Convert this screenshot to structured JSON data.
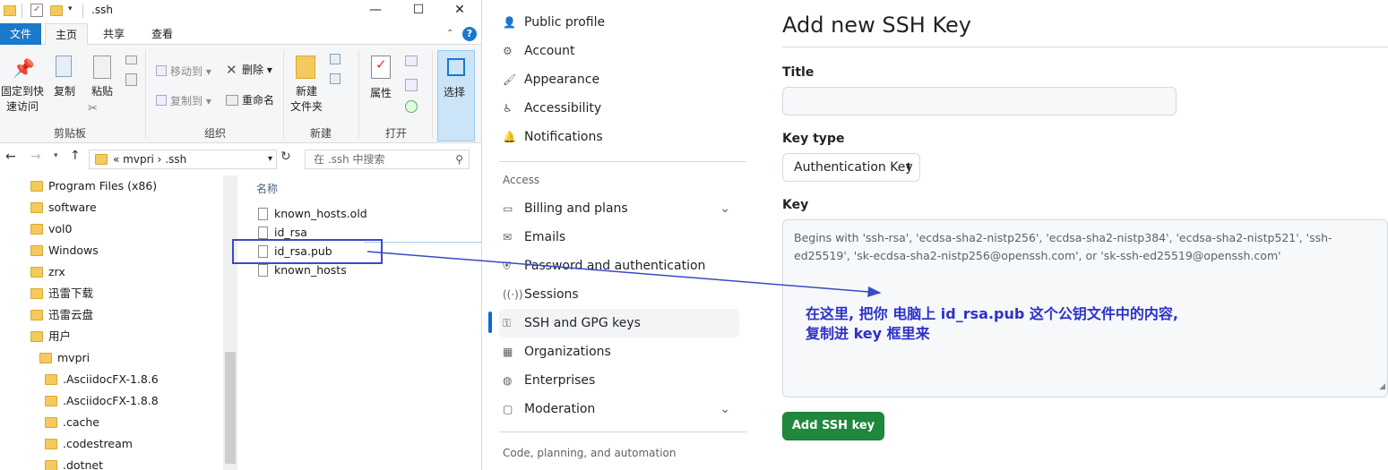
{
  "explorer": {
    "title": ".ssh",
    "window_controls": {
      "minimize": "—",
      "maximize": "☐",
      "close": "✕"
    },
    "tabs": {
      "file": "文件",
      "home": "主页",
      "share": "共享",
      "view": "查看"
    },
    "help": "?",
    "ribbon": {
      "pin": "固定到快\n速访问",
      "copy": "复制",
      "paste": "粘贴",
      "move_to": "移动到",
      "delete": "删除",
      "copy_to": "复制到",
      "rename": "重命名",
      "new_folder": "新建\n文件夹",
      "properties": "属性",
      "select": "选择",
      "groups": {
        "clipboard": "剪贴板",
        "organize": "组织",
        "new": "新建",
        "open": "打开"
      }
    },
    "address": {
      "path": "«  mvpri  ›  .ssh",
      "search_placeholder": "在 .ssh 中搜索"
    },
    "tree": [
      "Program Files (x86)",
      "software",
      "vol0",
      "Windows",
      "zrx",
      "迅雷下载",
      "迅雷云盘",
      "用户",
      "mvpri",
      ".AsciidocFX-1.8.6",
      ".AsciidocFX-1.8.8",
      ".cache",
      ".codestream",
      ".dotnet"
    ],
    "list_header": "名称",
    "files": [
      "known_hosts.old",
      "id_rsa",
      "id_rsa.pub",
      "known_hosts"
    ]
  },
  "github": {
    "nav": [
      {
        "label": "Public profile",
        "icon": "person-icon"
      },
      {
        "label": "Account",
        "icon": "gear-icon"
      },
      {
        "label": "Appearance",
        "icon": "paintbrush-icon"
      },
      {
        "label": "Accessibility",
        "icon": "accessibility-icon"
      },
      {
        "label": "Notifications",
        "icon": "bell-icon"
      }
    ],
    "section_access": "Access",
    "nav_access": [
      {
        "label": "Billing and plans",
        "icon": "credit-card-icon"
      },
      {
        "label": "Emails",
        "icon": "mail-icon"
      },
      {
        "label": "Password and authentication",
        "icon": "shield-lock-icon"
      },
      {
        "label": "Sessions",
        "icon": "broadcast-icon"
      },
      {
        "label": "SSH and GPG keys",
        "icon": "key-icon"
      },
      {
        "label": "Organizations",
        "icon": "organization-icon"
      },
      {
        "label": "Enterprises",
        "icon": "globe-icon"
      },
      {
        "label": "Moderation",
        "icon": "report-icon"
      }
    ],
    "section_code": "Code, planning, and automation",
    "page_title": "Add new SSH Key",
    "title_label": "Title",
    "key_type_label": "Key type",
    "key_type_value": "Authentication Key",
    "key_label": "Key",
    "key_placeholder": "Begins with 'ssh-rsa', 'ecdsa-sha2-nistp256', 'ecdsa-sha2-nistp384', 'ecdsa-sha2-nistp521', 'ssh-ed25519', 'sk-ecdsa-sha2-nistp256@openssh.com', or 'sk-ssh-ed25519@openssh.com'",
    "submit": "Add SSH key"
  },
  "annotation": {
    "line1": "在这里, 把你 电脑上 id_rsa.pub 这个公钥文件中的内容,",
    "line2": "复制进 key 框里来",
    "color": "#2d31c9"
  }
}
